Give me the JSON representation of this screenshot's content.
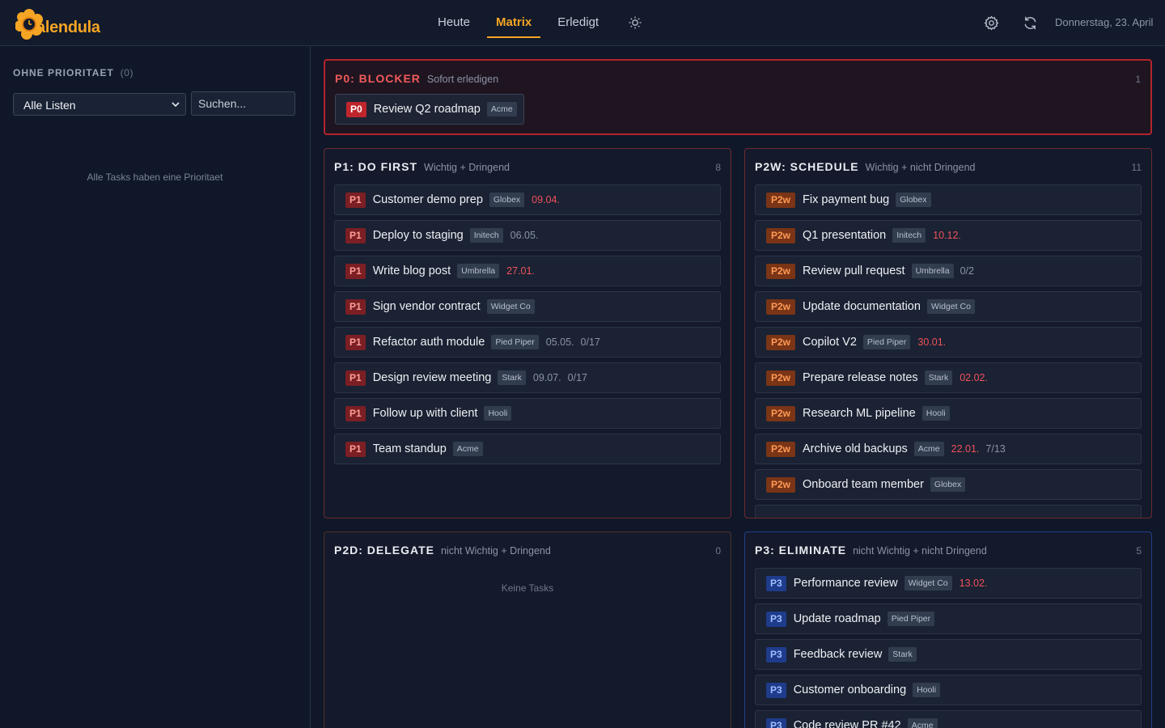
{
  "app": {
    "logo_text": "alendula",
    "nav": {
      "tab_today": "Heute",
      "tab_matrix": "Matrix",
      "tab_done": "Erledigt"
    },
    "date": "Donnerstag, 23. April",
    "brand_color": "#f5a524"
  },
  "sidebar": {
    "heading": "OHNE PRIORITAET",
    "count": "(0)",
    "list_filter": "Alle Listen",
    "search_placeholder": "Suchen...",
    "empty_text": "Alle Tasks haben eine Prioritaet"
  },
  "p0": {
    "title": "P0: BLOCKER",
    "subtitle": "Sofort erledigen",
    "count": "1",
    "tasks": [
      {
        "badge": "P0",
        "title": "Review Q2 roadmap",
        "tag": "Acme"
      }
    ]
  },
  "p1": {
    "title": "P1: DO FIRST",
    "subtitle": "Wichtig + Dringend",
    "count": "8",
    "tasks": [
      {
        "badge": "P1",
        "title": "Customer demo prep",
        "tag": "Globex",
        "due": "09.04.",
        "due_overdue": true
      },
      {
        "badge": "P1",
        "title": "Deploy to staging",
        "tag": "Initech",
        "due": "06.05.",
        "due_overdue": false
      },
      {
        "badge": "P1",
        "title": "Write blog post",
        "tag": "Umbrella",
        "due": "27.01.",
        "due_overdue": true
      },
      {
        "badge": "P1",
        "title": "Sign vendor contract",
        "tag": "Widget Co"
      },
      {
        "badge": "P1",
        "title": "Refactor auth module",
        "tag": "Pied Piper",
        "due": "05.05.",
        "due_overdue": false,
        "subtasks": "0/17"
      },
      {
        "badge": "P1",
        "title": "Design review meeting",
        "tag": "Stark",
        "due": "09.07.",
        "due_overdue": false,
        "subtasks": "0/17"
      },
      {
        "badge": "P1",
        "title": "Follow up with client",
        "tag": "Hooli"
      },
      {
        "badge": "P1",
        "title": "Team standup",
        "tag": "Acme"
      }
    ]
  },
  "p2w": {
    "title": "P2W: SCHEDULE",
    "subtitle": "Wichtig + nicht Dringend",
    "count": "11",
    "tasks": [
      {
        "badge": "P2w",
        "title": "Fix payment bug",
        "tag": "Globex"
      },
      {
        "badge": "P2w",
        "title": "Q1 presentation",
        "tag": "Initech",
        "due": "10.12.",
        "due_overdue": true
      },
      {
        "badge": "P2w",
        "title": "Review pull request",
        "tag": "Umbrella",
        "subtasks": "0/2"
      },
      {
        "badge": "P2w",
        "title": "Update documentation",
        "tag": "Widget Co"
      },
      {
        "badge": "P2w",
        "title": "Copilot V2",
        "tag": "Pied Piper",
        "due": "30.01.",
        "due_overdue": true
      },
      {
        "badge": "P2w",
        "title": "Prepare release notes",
        "tag": "Stark",
        "due": "02.02.",
        "due_overdue": true
      },
      {
        "badge": "P2w",
        "title": "Research ML pipeline",
        "tag": "Hooli"
      },
      {
        "badge": "P2w",
        "title": "Archive old backups",
        "tag": "Acme",
        "due": "22.01.",
        "due_overdue": true,
        "subtasks": "7/13"
      },
      {
        "badge": "P2w",
        "title": "Onboard team member",
        "tag": "Globex"
      },
      {
        "badge": "",
        "title": "",
        "tag": ""
      }
    ]
  },
  "p2d": {
    "title": "P2D: DELEGATE",
    "subtitle": "nicht Wichtig + Dringend",
    "count": "0",
    "empty_text": "Keine Tasks"
  },
  "p3": {
    "title": "P3: ELIMINATE",
    "subtitle": "nicht Wichtig + nicht Dringend",
    "count": "5",
    "tasks": [
      {
        "badge": "P3",
        "title": "Performance review",
        "tag": "Widget Co",
        "due": "13.02.",
        "due_overdue": true
      },
      {
        "badge": "P3",
        "title": "Update roadmap",
        "tag": "Pied Piper"
      },
      {
        "badge": "P3",
        "title": "Feedback review",
        "tag": "Stark"
      },
      {
        "badge": "P3",
        "title": "Customer onboarding",
        "tag": "Hooli"
      },
      {
        "badge": "P3",
        "title": "Code review PR #42",
        "tag": "Acme"
      }
    ]
  }
}
